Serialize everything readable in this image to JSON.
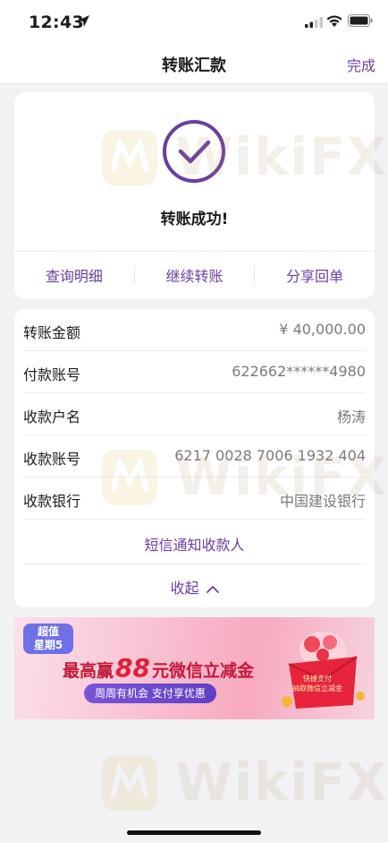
{
  "status_bar": {
    "time": "12:43",
    "icons": [
      "location-arrow-icon",
      "cellular-signal-icon",
      "wifi-icon",
      "battery-icon"
    ]
  },
  "nav": {
    "title": "转账汇款",
    "done_label": "完成"
  },
  "success": {
    "icon": "checkmark-circle-icon",
    "message": "转账成功!",
    "actions": [
      "查询明细",
      "继续转账",
      "分享回单"
    ]
  },
  "details": {
    "rows": [
      {
        "label": "转账金额",
        "value": "¥ 40,000.00"
      },
      {
        "label": "付款账号",
        "value": "622662******4980"
      },
      {
        "label": "收款户名",
        "value": "杨涛"
      },
      {
        "label": "收款账号",
        "value": "6217 0028 7006 1932 404"
      },
      {
        "label": "收款银行",
        "value": "中国建设银行"
      }
    ],
    "sms_link": "短信通知收款人",
    "collapse_label": "收起"
  },
  "banner": {
    "badge_line1": "超值",
    "badge_line2": "星期5",
    "headline_pre": "最高赢",
    "headline_amount": "88",
    "headline_post": "元微信立减金",
    "pill_text": "周周有机会  支付享优惠",
    "envelope_line1": "快捷支付",
    "envelope_line2": "抽取微信立减金"
  },
  "watermark_text": "WikiFX",
  "colors": {
    "accent": "#6a3fa0",
    "page_bg": "#f2f2f4",
    "card_bg": "#ffffff",
    "value_gray": "#7a7a80"
  }
}
